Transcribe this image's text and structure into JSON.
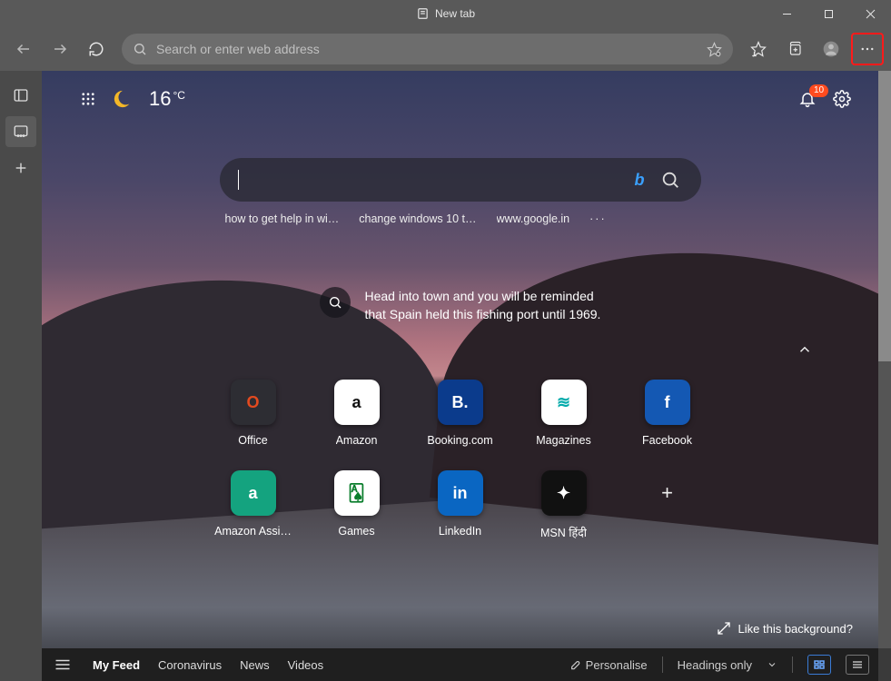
{
  "window": {
    "title": "New tab"
  },
  "toolbar": {
    "address_placeholder": "Search or enter web address"
  },
  "tabs": [
    {
      "label": "Booking.com"
    }
  ],
  "ntp": {
    "weather": {
      "temp": "16",
      "unit": "°C"
    },
    "notifications_count": "10",
    "suggestions": [
      "how to get help in wi…",
      "change windows 10 t…",
      "www.google.in"
    ],
    "info_text": "Head into town and you will be reminded that Spain held this fishing port until 1969.",
    "tiles_row1": [
      {
        "label": "Office",
        "letter": "O",
        "bg": "#2d2d33",
        "fg": "#e34a1f"
      },
      {
        "label": "Amazon",
        "letter": "a",
        "bg": "#ffffff",
        "fg": "#111"
      },
      {
        "label": "Booking.com",
        "letter": "B.",
        "bg": "#0b3b8c",
        "fg": "#fff"
      },
      {
        "label": "Magazines",
        "letter": "≋",
        "bg": "#ffffff",
        "fg": "#0aa"
      },
      {
        "label": "Facebook",
        "letter": "f",
        "bg": "#1458b3",
        "fg": "#fff"
      }
    ],
    "tiles_row2": [
      {
        "label": "Amazon Assi…",
        "letter": "a",
        "bg": "#14a37f",
        "fg": "#fff"
      },
      {
        "label": "Games",
        "letter": "🂡",
        "bg": "#ffffff",
        "fg": "#0a7d2c"
      },
      {
        "label": "LinkedIn",
        "letter": "in",
        "bg": "#0a66c2",
        "fg": "#fff"
      },
      {
        "label": "MSN हिंदी",
        "letter": "✦",
        "bg": "#111",
        "fg": "#fff"
      }
    ],
    "like_bg_label": "Like this background?"
  },
  "feed": {
    "tabs": [
      "My Feed",
      "Coronavirus",
      "News",
      "Videos"
    ],
    "active_index": 0,
    "personalise_label": "Personalise",
    "headings_label": "Headings only"
  }
}
